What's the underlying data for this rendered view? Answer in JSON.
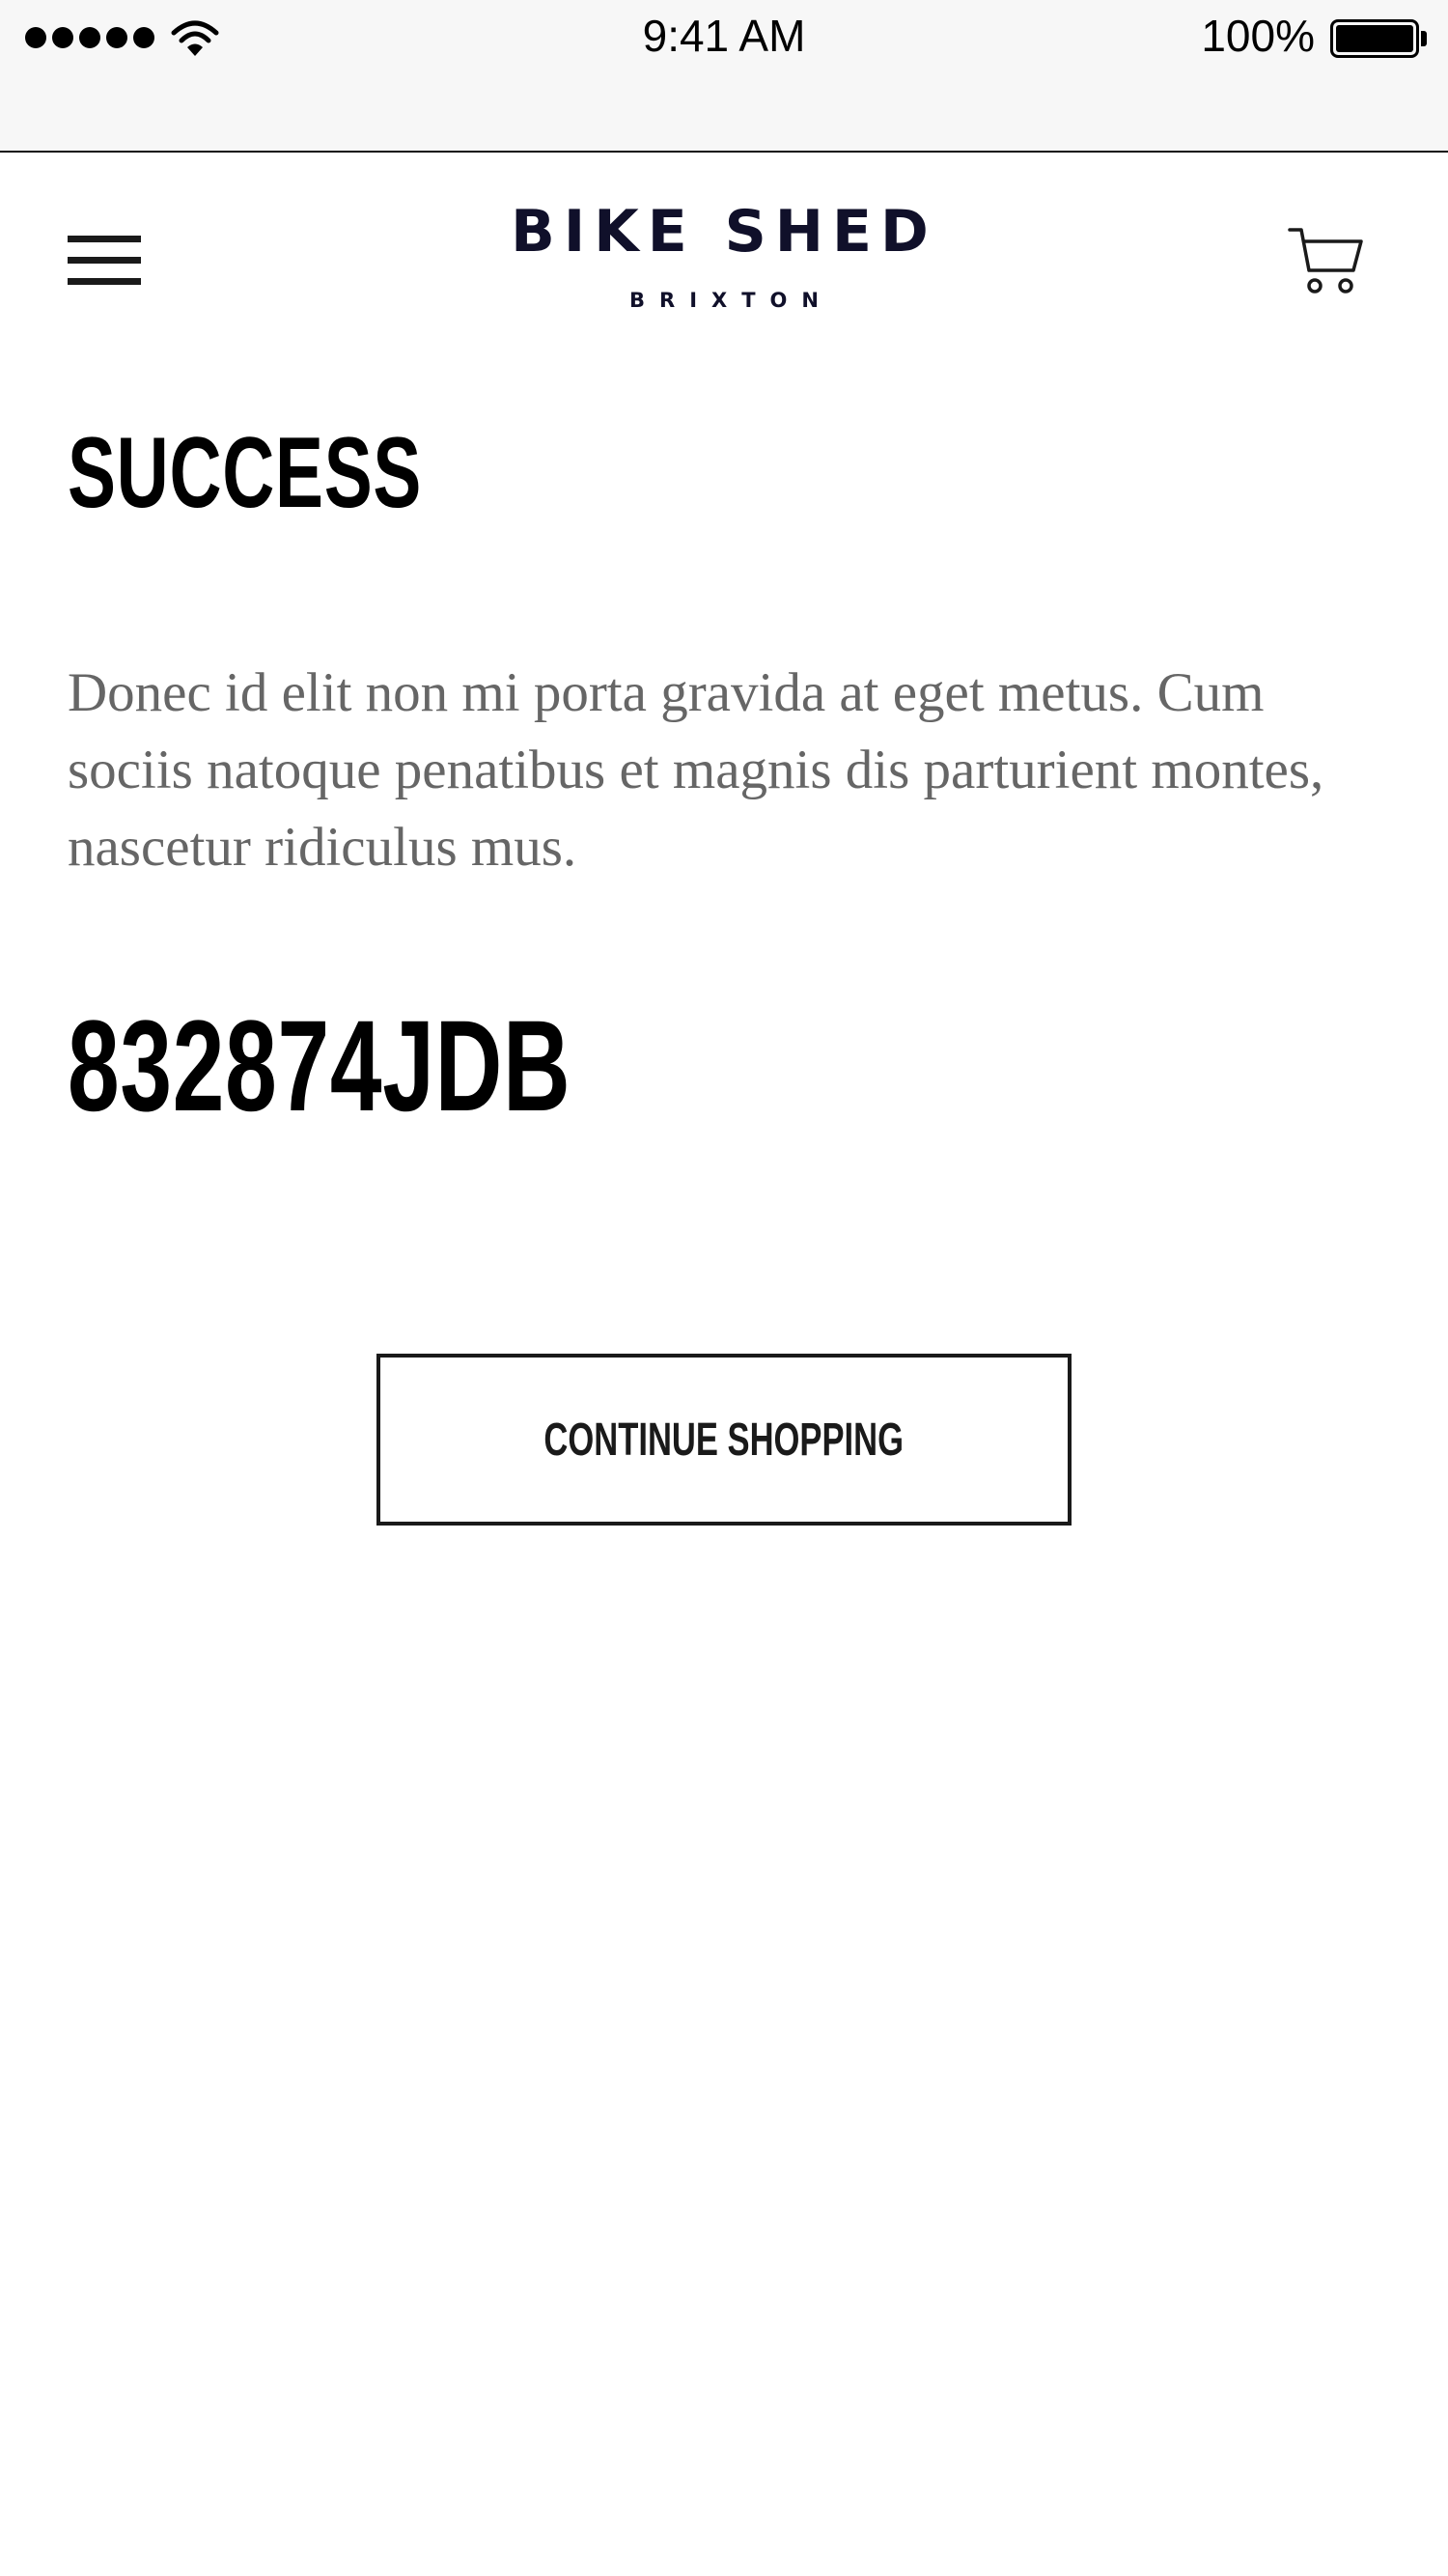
{
  "status_bar": {
    "time": "9:41 AM",
    "battery": "100%",
    "signal_icon": "signal-dots-icon",
    "wifi_icon": "wifi-icon",
    "battery_icon": "battery-icon"
  },
  "header": {
    "menu_icon": "hamburger-menu-icon",
    "logo_main": "BIKE SHED",
    "logo_sub": "BRIXTON",
    "cart_icon": "shopping-cart-icon"
  },
  "main": {
    "title": "SUCCESS",
    "body": "Donec id elit non mi porta gravida at eget metus. Cum sociis natoque penatibus et magnis dis parturient montes, nascetur ridiculus mus.",
    "order_code": "832874JDB",
    "continue_label": "CONTINUE SHOPPING"
  },
  "colors": {
    "text": "#000000",
    "body_text": "#666666",
    "logo": "#10102a",
    "status_bar_bg": "#f7f7f7"
  }
}
